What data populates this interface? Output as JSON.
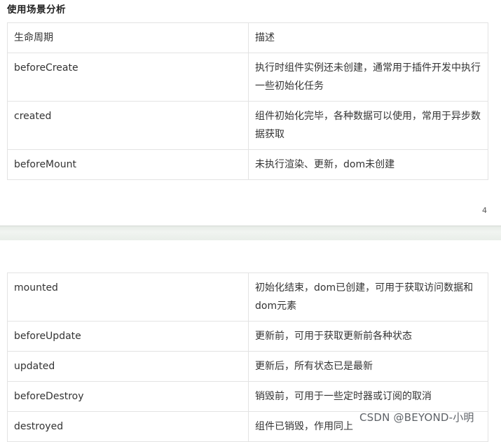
{
  "heading": "使用场景分析",
  "page_number": "4",
  "table1": {
    "headers": [
      "生命周期",
      "描述"
    ],
    "rows": [
      [
        "beforeCreate",
        "执行时组件实例还未创建，通常用于插件开发中执行一些初始化任务"
      ],
      [
        "created",
        "组件初始化完毕，各种数据可以使用，常用于异步数据获取"
      ],
      [
        "beforeMount",
        "未执行渲染、更新，dom未创建"
      ]
    ]
  },
  "table2": {
    "rows": [
      [
        "mounted",
        "初始化结束，dom已创建，可用于获取访问数据和dom元素"
      ],
      [
        "beforeUpdate",
        "更新前，可用于获取更新前各种状态"
      ],
      [
        "updated",
        "更新后，所有状态已是最新"
      ],
      [
        "beforeDestroy",
        "销毁前，可用于一些定时器或订阅的取消"
      ],
      [
        "destroyed",
        "组件已销毁，作用同上"
      ]
    ]
  },
  "watermark": "CSDN @BEYOND-小明"
}
